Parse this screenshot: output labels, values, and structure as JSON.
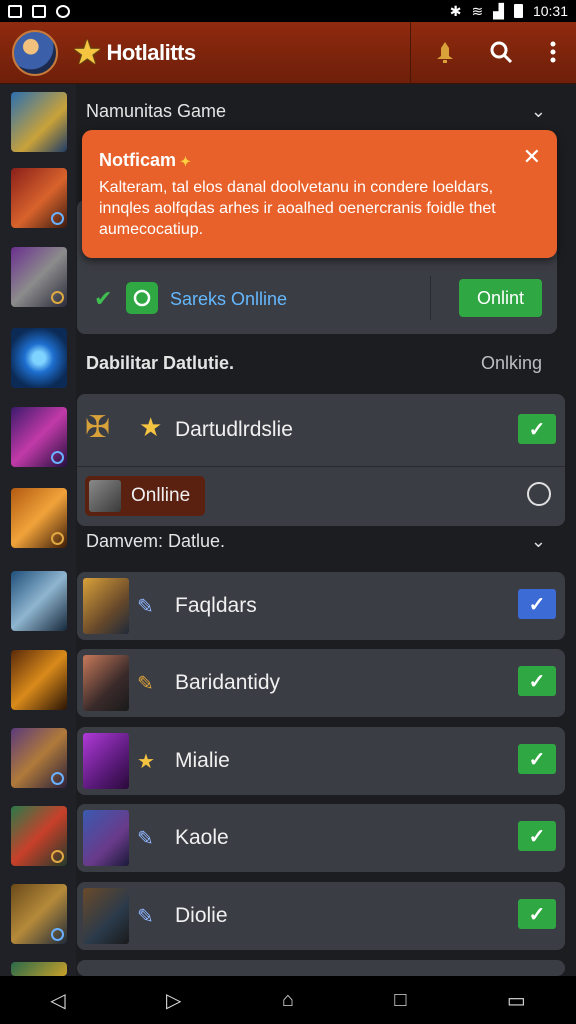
{
  "status_bar": {
    "time": "10:31"
  },
  "app_bar": {
    "title": "Hotlalitts"
  },
  "section1": {
    "title": "Namunitas Game"
  },
  "notification": {
    "title": "Notficam",
    "body": "Kalteram, tal elos danal doolvetanu in condere loeldars, innqles aolfqdas arhes ir aoalhed oenercranis foidle thet aumecocatiup."
  },
  "presence_row": {
    "label": "Sareks Onlline",
    "button_label": "Onlint"
  },
  "section2": {
    "title": "Dabilitar Datlutie.",
    "right_label": "Onlking"
  },
  "item_main": {
    "label": "Dartudlrdslie"
  },
  "online_chip": {
    "label": "Onlline"
  },
  "section3": {
    "title": "Damvem: Datlue."
  },
  "games": [
    {
      "label": "Faqldars",
      "checked": true,
      "style": "blue"
    },
    {
      "label": "Baridantidy",
      "checked": true,
      "style": "green"
    },
    {
      "label": "Mialie",
      "checked": true,
      "style": "green"
    },
    {
      "label": "Kaole",
      "checked": true,
      "style": "green"
    },
    {
      "label": "Diolie",
      "checked": true,
      "style": "green"
    }
  ],
  "colors": {
    "app_bar": "#7a230b",
    "notification": "#e8612a",
    "check_green": "#2fa843",
    "check_blue": "#3d6bd6",
    "panel": "#3b3d44"
  }
}
